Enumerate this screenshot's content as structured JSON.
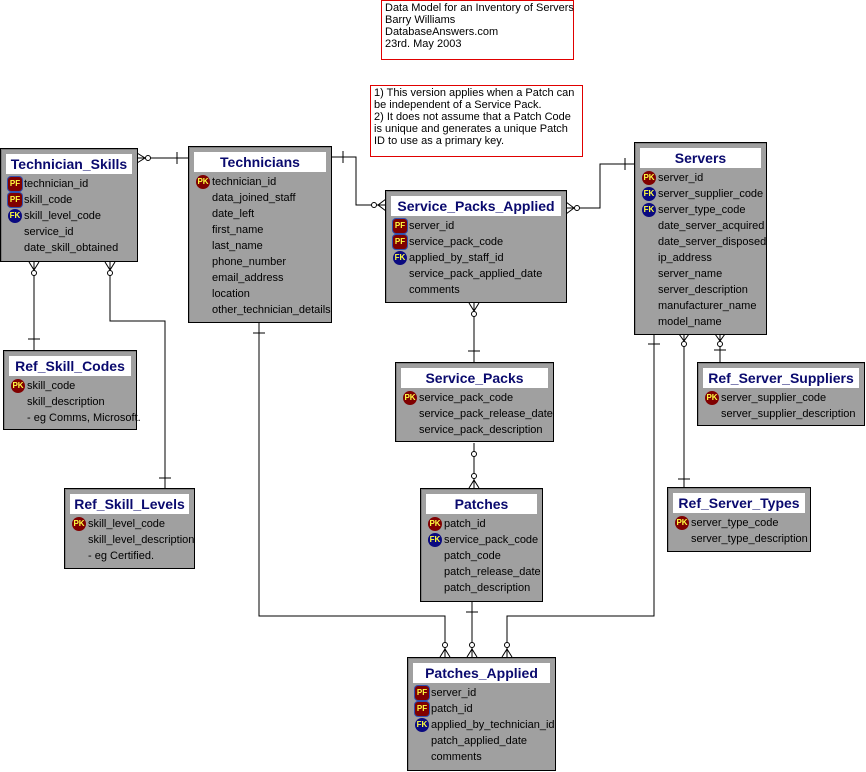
{
  "notes": {
    "header": [
      "Data Model for an Inventory of Servers",
      "Barry Williams",
      "DatabaseAnswers.com",
      "23rd. May 2003"
    ],
    "remarks": [
      "1) This version applies when a Patch can",
      "be independent of a Service Pack.",
      "2) It does not assume that a Patch Code",
      "is unique and generates a unique Patch",
      "ID to use as a primary key."
    ]
  },
  "colors": {
    "entity_fill": "#a0a0a0",
    "title_text": "#0a0a6e",
    "note_border": "#e00000",
    "pk_badge": "#800000",
    "fk_badge": "#0a0a80"
  },
  "entities": {
    "technician_skills": {
      "name": "Technician_Skills",
      "attrs": [
        {
          "key": "PF",
          "name": "technician_id"
        },
        {
          "key": "PF",
          "name": "skill_code"
        },
        {
          "key": "FK",
          "name": "skill_level_code"
        },
        {
          "key": "",
          "name": "service_id"
        },
        {
          "key": "",
          "name": "date_skill_obtained"
        }
      ]
    },
    "technicians": {
      "name": "Technicians",
      "attrs": [
        {
          "key": "PK",
          "name": "technician_id"
        },
        {
          "key": "",
          "name": "data_joined_staff"
        },
        {
          "key": "",
          "name": "date_left"
        },
        {
          "key": "",
          "name": "first_name"
        },
        {
          "key": "",
          "name": "last_name"
        },
        {
          "key": "",
          "name": "phone_number"
        },
        {
          "key": "",
          "name": "email_address"
        },
        {
          "key": "",
          "name": "location"
        },
        {
          "key": "",
          "name": "other_technician_details"
        }
      ]
    },
    "service_packs_applied": {
      "name": "Service_Packs_Applied",
      "attrs": [
        {
          "key": "PF",
          "name": "server_id"
        },
        {
          "key": "PF",
          "name": "service_pack_code"
        },
        {
          "key": "FK",
          "name": "applied_by_staff_id"
        },
        {
          "key": "",
          "name": "service_pack_applied_date"
        },
        {
          "key": "",
          "name": "comments"
        }
      ]
    },
    "servers": {
      "name": "Servers",
      "attrs": [
        {
          "key": "PK",
          "name": "server_id"
        },
        {
          "key": "FK",
          "name": "server_supplier_code"
        },
        {
          "key": "FK",
          "name": "server_type_code"
        },
        {
          "key": "",
          "name": "date_server_acquired"
        },
        {
          "key": "",
          "name": "date_server_disposed"
        },
        {
          "key": "",
          "name": "ip_address"
        },
        {
          "key": "",
          "name": "server_name"
        },
        {
          "key": "",
          "name": "server_description"
        },
        {
          "key": "",
          "name": "manufacturer_name"
        },
        {
          "key": "",
          "name": "model_name"
        }
      ]
    },
    "ref_skill_codes": {
      "name": "Ref_Skill_Codes",
      "attrs": [
        {
          "key": "PK",
          "name": "skill_code"
        },
        {
          "key": "",
          "name": "skill_description"
        },
        {
          "key": "",
          "name": "- eg Comms, Microsoft."
        }
      ]
    },
    "ref_skill_levels": {
      "name": "Ref_Skill_Levels",
      "attrs": [
        {
          "key": "PK",
          "name": "skill_level_code"
        },
        {
          "key": "",
          "name": "skill_level_description"
        },
        {
          "key": "",
          "name": "- eg Certified."
        }
      ]
    },
    "service_packs": {
      "name": "Service_Packs",
      "attrs": [
        {
          "key": "PK",
          "name": "service_pack_code"
        },
        {
          "key": "",
          "name": "service_pack_release_date"
        },
        {
          "key": "",
          "name": "service_pack_description"
        }
      ]
    },
    "ref_server_suppliers": {
      "name": "Ref_Server_Suppliers",
      "attrs": [
        {
          "key": "PK",
          "name": "server_supplier_code"
        },
        {
          "key": "",
          "name": "server_supplier_description"
        }
      ]
    },
    "patches": {
      "name": "Patches",
      "attrs": [
        {
          "key": "PK",
          "name": "patch_id"
        },
        {
          "key": "FK",
          "name": "service_pack_code"
        },
        {
          "key": "",
          "name": "patch_code"
        },
        {
          "key": "",
          "name": "patch_release_date"
        },
        {
          "key": "",
          "name": "patch_description"
        }
      ]
    },
    "ref_server_types": {
      "name": "Ref_Server_Types",
      "attrs": [
        {
          "key": "PK",
          "name": "server_type_code"
        },
        {
          "key": "",
          "name": "server_type_description"
        }
      ]
    },
    "patches_applied": {
      "name": "Patches_Applied",
      "attrs": [
        {
          "key": "PF",
          "name": "server_id"
        },
        {
          "key": "PF",
          "name": "patch_id"
        },
        {
          "key": "FK",
          "name": "applied_by_technician_id"
        },
        {
          "key": "",
          "name": "patch_applied_date"
        },
        {
          "key": "",
          "name": "comments"
        }
      ]
    }
  },
  "relationships": [
    {
      "from": "technicians",
      "to": "technician_skills",
      "cardinality": "one-to-many"
    },
    {
      "from": "technicians",
      "to": "service_packs_applied",
      "cardinality": "one-to-many"
    },
    {
      "from": "servers",
      "to": "service_packs_applied",
      "cardinality": "one-to-many"
    },
    {
      "from": "ref_skill_codes",
      "to": "technician_skills",
      "cardinality": "one-to-many"
    },
    {
      "from": "ref_skill_levels",
      "to": "technician_skills",
      "cardinality": "one-to-many"
    },
    {
      "from": "service_packs",
      "to": "service_packs_applied",
      "cardinality": "one-to-many"
    },
    {
      "from": "service_packs",
      "to": "patches",
      "cardinality": "zero-or-one-to-many"
    },
    {
      "from": "ref_server_suppliers",
      "to": "servers",
      "cardinality": "one-to-many"
    },
    {
      "from": "ref_server_types",
      "to": "servers",
      "cardinality": "one-to-many"
    },
    {
      "from": "technicians",
      "to": "patches_applied",
      "cardinality": "one-to-many"
    },
    {
      "from": "patches",
      "to": "patches_applied",
      "cardinality": "one-to-many"
    },
    {
      "from": "servers",
      "to": "patches_applied",
      "cardinality": "one-to-many"
    }
  ]
}
